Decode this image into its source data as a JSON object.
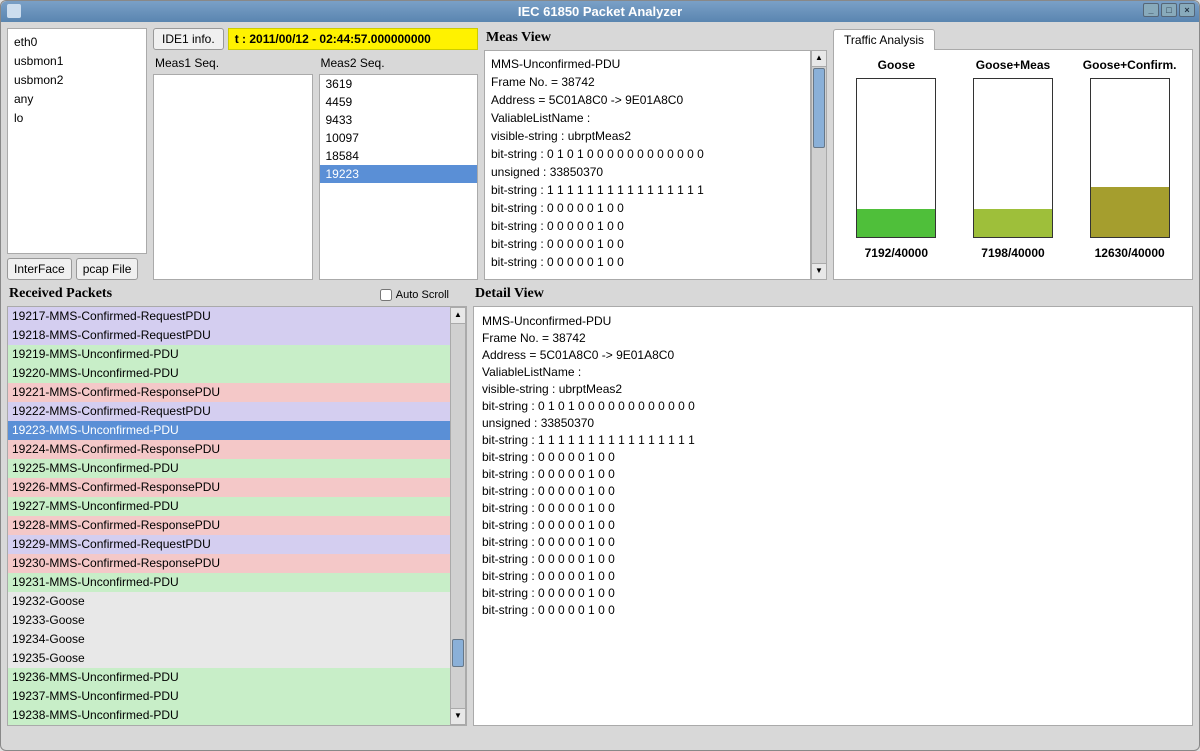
{
  "window": {
    "title": "IEC 61850 Packet Analyzer"
  },
  "interface": {
    "items": [
      "eth0",
      "usbmon1",
      "usbmon2",
      "any",
      "lo"
    ],
    "buttons": [
      "InterFace",
      "pcap File"
    ]
  },
  "ide": {
    "tab": "IDE1 info.",
    "timestamp": "t : 2011/00/12 - 02:44:57.000000000",
    "meas1": {
      "label": "Meas1 Seq.",
      "items": []
    },
    "meas2": {
      "label": "Meas2 Seq.",
      "items": [
        "3619",
        "4459",
        "9433",
        "10097",
        "18584",
        "19223"
      ],
      "selected": "19223"
    }
  },
  "measView": {
    "title": "Meas View",
    "lines": [
      "MMS-Unconfirmed-PDU",
      "Frame No. = 38742",
      "Address = 5C01A8C0 -> 9E01A8C0",
      "ValiableListName :",
      "visible-string : ubrptMeas2",
      "bit-string : 0 1 0 1 0 0 0 0 0 0 0 0 0 0 0 0",
      "unsigned : 33850370",
      "bit-string : 1 1 1 1 1 1 1 1 1 1 1 1 1 1 1 1",
      "bit-string : 0 0 0 0 0 1 0 0",
      "bit-string : 0 0 0 0 0 1 0 0",
      "bit-string : 0 0 0 0 0 1 0 0",
      "bit-string : 0 0 0 0 0 1 0 0"
    ]
  },
  "traffic": {
    "tab": "Traffic Analysis",
    "bars": [
      {
        "title": "Goose",
        "value": 7192,
        "max": 40000,
        "color": "#4fbf3a"
      },
      {
        "title": "Goose+Meas",
        "value": 7198,
        "max": 40000,
        "color": "#9ebf3a"
      },
      {
        "title": "Goose+Confirm.",
        "value": 12630,
        "max": 40000,
        "color": "#a59e2e"
      }
    ]
  },
  "received": {
    "title": "Received Packets",
    "autoscroll": "Auto Scroll",
    "packets": [
      {
        "text": "19217-MMS-Confirmed-RequestPDU",
        "type": "req"
      },
      {
        "text": "19218-MMS-Confirmed-RequestPDU",
        "type": "req"
      },
      {
        "text": "19219-MMS-Unconfirmed-PDU",
        "type": "unc"
      },
      {
        "text": "19220-MMS-Unconfirmed-PDU",
        "type": "unc"
      },
      {
        "text": "19221-MMS-Confirmed-ResponsePDU",
        "type": "res"
      },
      {
        "text": "19222-MMS-Confirmed-RequestPDU",
        "type": "req"
      },
      {
        "text": "19223-MMS-Unconfirmed-PDU",
        "type": "sel"
      },
      {
        "text": "19224-MMS-Confirmed-ResponsePDU",
        "type": "res"
      },
      {
        "text": "19225-MMS-Unconfirmed-PDU",
        "type": "unc"
      },
      {
        "text": "19226-MMS-Confirmed-ResponsePDU",
        "type": "res"
      },
      {
        "text": "19227-MMS-Unconfirmed-PDU",
        "type": "unc"
      },
      {
        "text": "19228-MMS-Confirmed-ResponsePDU",
        "type": "res"
      },
      {
        "text": "19229-MMS-Confirmed-RequestPDU",
        "type": "req"
      },
      {
        "text": "19230-MMS-Confirmed-ResponsePDU",
        "type": "res"
      },
      {
        "text": "19231-MMS-Unconfirmed-PDU",
        "type": "unc"
      },
      {
        "text": "19232-Goose",
        "type": "goose"
      },
      {
        "text": "19233-Goose",
        "type": "goose"
      },
      {
        "text": "19234-Goose",
        "type": "goose"
      },
      {
        "text": "19235-Goose",
        "type": "goose"
      },
      {
        "text": "19236-MMS-Unconfirmed-PDU",
        "type": "unc"
      },
      {
        "text": "19237-MMS-Unconfirmed-PDU",
        "type": "unc"
      },
      {
        "text": "19238-MMS-Unconfirmed-PDU",
        "type": "unc"
      }
    ]
  },
  "detail": {
    "title": "Detail View",
    "lines": [
      "MMS-Unconfirmed-PDU",
      "Frame No. = 38742",
      "Address = 5C01A8C0 -> 9E01A8C0",
      "ValiableListName :",
      "visible-string : ubrptMeas2",
      "bit-string : 0 1 0 1 0 0 0 0 0 0 0 0 0 0 0 0",
      "unsigned : 33850370",
      "bit-string : 1 1 1 1 1 1 1 1 1 1 1 1 1 1 1 1",
      "bit-string : 0 0 0 0 0 1 0 0",
      "bit-string : 0 0 0 0 0 1 0 0",
      "bit-string : 0 0 0 0 0 1 0 0",
      "bit-string : 0 0 0 0 0 1 0 0",
      "bit-string : 0 0 0 0 0 1 0 0",
      "bit-string : 0 0 0 0 0 1 0 0",
      "bit-string : 0 0 0 0 0 1 0 0",
      "bit-string : 0 0 0 0 0 1 0 0",
      "bit-string : 0 0 0 0 0 1 0 0",
      "bit-string : 0 0 0 0 0 1 0 0"
    ]
  },
  "chart_data": {
    "type": "bar",
    "categories": [
      "Goose",
      "Goose+Meas",
      "Goose+Confirm."
    ],
    "values": [
      7192,
      7198,
      12630
    ],
    "title": "Traffic Analysis",
    "xlabel": "",
    "ylabel": "",
    "ylim": [
      0,
      40000
    ]
  }
}
